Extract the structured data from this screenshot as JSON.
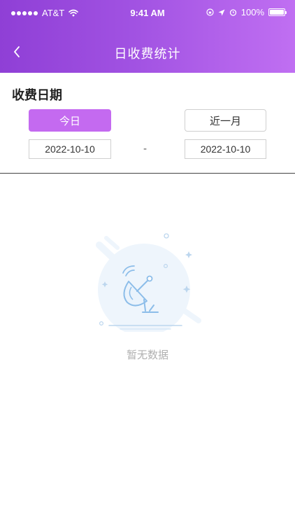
{
  "status_bar": {
    "carrier": "AT&T",
    "time": "9:41 AM",
    "battery": "100%"
  },
  "nav": {
    "title": "日收费统计"
  },
  "filter": {
    "section_title": "收费日期",
    "today_label": "今日",
    "month_label": "近一月",
    "start_date": "2022-10-10",
    "separator": "-",
    "end_date": "2022-10-10"
  },
  "empty_state": {
    "message": "暂无数据",
    "icon": "satellite-dish-icon"
  },
  "colors": {
    "header_gradient_start": "#8f3fd6",
    "header_gradient_end": "#c06ff2",
    "accent": "#c46af0",
    "empty_text": "#b0b0b0"
  }
}
